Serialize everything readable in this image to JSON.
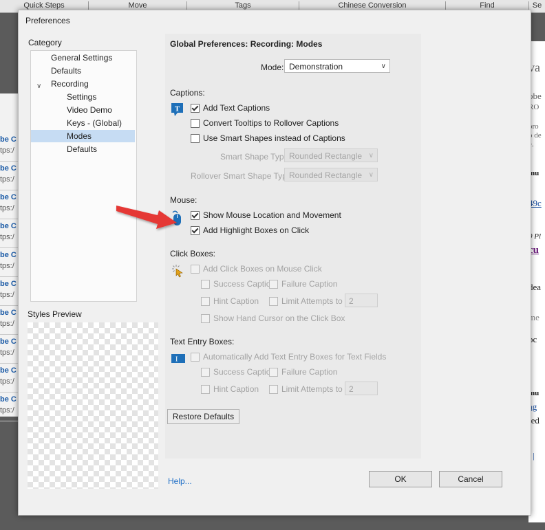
{
  "background": {
    "tabs": [
      "Quick Steps",
      "Move",
      "Tags",
      "Chinese Conversion",
      "Find",
      "Se"
    ],
    "left_rows": [
      {
        "title": "be C",
        "sub": "tps:/"
      },
      {
        "title": "be C",
        "sub": "tps:/"
      },
      {
        "title": "be C",
        "sub": "tps:/"
      },
      {
        "title": "be C",
        "sub": "tps:/"
      },
      {
        "title": "be C",
        "sub": "tps:/"
      },
      {
        "title": "be C",
        "sub": "tps:/"
      },
      {
        "title": "be C",
        "sub": "tps:/"
      },
      {
        "title": "be C",
        "sub": "tps:/"
      },
      {
        "title": "be C",
        "sub": "tps:/"
      },
      {
        "title": "be C",
        "sub": "tps:/"
      },
      {
        "title": "be C",
        "sub": "tps:/"
      }
    ],
    "right_text": [
      "va",
      "obe",
      "RO",
      "pro",
      "o de",
      "e.",
      "mu",
      "49c",
      "0 Pl",
      "cu",
      "dea",
      "me",
      "pc",
      "mu",
      "ag",
      "ted",
      "/ |"
    ]
  },
  "dialog": {
    "title": "Preferences",
    "category_label": "Category",
    "tree": [
      {
        "label": "General Settings",
        "selected": false
      },
      {
        "label": "Defaults",
        "selected": false
      },
      {
        "label": "Recording",
        "selected": false
      },
      {
        "label": "Settings",
        "selected": false
      },
      {
        "label": "Video Demo",
        "selected": false
      },
      {
        "label": "Keys - (Global)",
        "selected": false
      },
      {
        "label": "Modes",
        "selected": true
      },
      {
        "label": "Defaults",
        "selected": false
      }
    ],
    "styles_preview_label": "Styles Preview",
    "heading": "Global Preferences: Recording: Modes",
    "mode": {
      "label": "Mode:",
      "value": "Demonstration"
    },
    "captions": {
      "label": "Captions:",
      "add_text_captions": {
        "label": "Add Text Captions",
        "checked": true
      },
      "convert_tooltips": {
        "label": "Convert Tooltips to Rollover Captions",
        "checked": false
      },
      "use_smart_shapes": {
        "label": "Use Smart Shapes instead of Captions",
        "checked": false
      },
      "smart_shape_type": {
        "label": "Smart Shape Type",
        "value": "Rounded Rectangle"
      },
      "rollover_smart_shape_type": {
        "label": "Rollover Smart Shape Type",
        "value": "Rounded Rectangle"
      }
    },
    "mouse": {
      "label": "Mouse:",
      "show_mouse": {
        "label": "Show Mouse Location and Movement",
        "checked": true
      },
      "add_highlight": {
        "label": "Add Highlight Boxes on Click",
        "checked": true
      }
    },
    "click_boxes": {
      "label": "Click Boxes:",
      "add_click_boxes": "Add Click Boxes on Mouse Click",
      "success_caption": "Success Caption",
      "failure_caption": "Failure Caption",
      "hint_caption": "Hint Caption",
      "limit_attempts": "Limit Attempts to",
      "limit_value": "2",
      "show_hand_cursor": "Show Hand Cursor on the Click Box"
    },
    "text_entry": {
      "label": "Text Entry Boxes:",
      "auto_add": "Automatically Add Text Entry Boxes for Text Fields",
      "success_caption": "Success Caption",
      "failure_caption": "Failure Caption",
      "hint_caption": "Hint Caption",
      "limit_attempts": "Limit Attempts to",
      "limit_value": "2"
    },
    "restore_defaults": "Restore Defaults",
    "help": "Help...",
    "ok": "OK",
    "cancel": "Cancel"
  },
  "colors": {
    "accent_arrow": "#e53935",
    "selection": "#c6dcf3",
    "link": "#1f6fc7"
  }
}
